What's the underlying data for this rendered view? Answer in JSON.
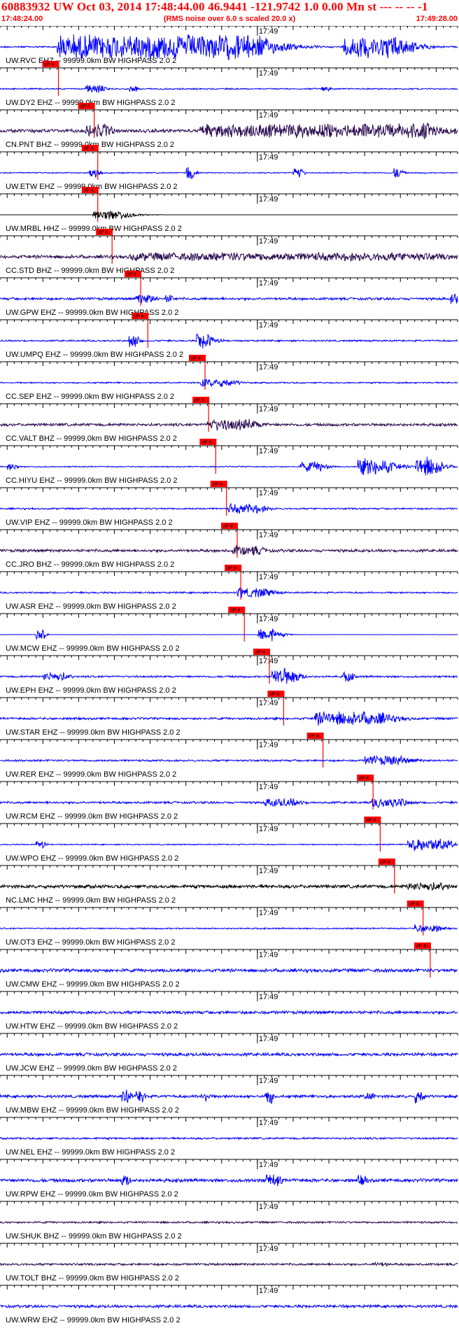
{
  "header": {
    "title": "60883932 UW Oct 03, 2014 17:48:44.00    46.9441 -121.9742  1.0 0.00 Mn st --- -- --   -1",
    "start_time": "17:48:24.00",
    "end_time": "17:49:28.00",
    "rms_note": "(RMS noise over 6.0 s scaled 20.0 x)"
  },
  "colors": {
    "title": "#ff0000",
    "pick_box": "#ff0000",
    "trace_blue": "#0000ff",
    "trace_dark": "#2a0a50",
    "trace_black": "#000000",
    "axis": "#000000"
  },
  "chart_data": {
    "type": "line",
    "title": "60883932 UW Oct 03, 2014 17:48:44.00    46.9441 -121.9742  1.0 0.00 Mn st --- -- --   -1",
    "x_range": [
      "17:48:24.00",
      "17:49:28.00"
    ],
    "minute_tick_label": "17:49",
    "pick_label": "xP 4",
    "tick_interval_s": 1,
    "grid": false,
    "filter_note": "(RMS noise over 6.0 s scaled 20.0 x)",
    "series": [
      {
        "name": "UW.RVC EHZ -- 99999.0km BW  HIGHPASS  2.0  2",
        "color": "#0000ff",
        "pick_s": 7.0,
        "bursts": [
          [
            8,
            36,
            6,
            0.9
          ],
          [
            48,
            56,
            4,
            0.8
          ]
        ],
        "base": 0.06
      },
      {
        "name": "UW.DY2 EHZ -- 99999.0km BW  HIGHPASS  2.0  2",
        "color": "#0000ff",
        "pick_s": 12.0,
        "bursts": [
          [
            12,
            14,
            2,
            0.3
          ],
          [
            18,
            19,
            1,
            0.2
          ],
          [
            45,
            46,
            1,
            0.2
          ]
        ],
        "base": 0.05
      },
      {
        "name": "CN.PNT BHZ -- 99999.0km BW  HIGHPASS  2.0  2",
        "color": "#2a0a50",
        "pick_s": 12.5,
        "bursts": [
          [
            12,
            15,
            2,
            0.5
          ],
          [
            28,
            60,
            8,
            0.5
          ],
          [
            57,
            60,
            3,
            0.6
          ]
        ],
        "base": 0.12
      },
      {
        "name": "UW.ETW EHZ -- 99999.0km BW  HIGHPASS  2.0  2",
        "color": "#0000ff",
        "pick_s": 12.5,
        "bursts": [
          [
            12.5,
            13.5,
            1,
            0.35
          ],
          [
            26,
            27,
            0.8,
            0.5
          ],
          [
            41,
            42,
            0.8,
            0.5
          ],
          [
            55,
            56,
            0.8,
            0.4
          ]
        ],
        "base": 0.04
      },
      {
        "name": "UW.MRBL HHZ -- 99999.0km BW  HIGHPASS  2.0  2",
        "color": "#000000",
        "pick_s": 14.5,
        "bursts": [
          [
            13,
            17,
            3,
            0.35
          ]
        ],
        "base": 0.0
      },
      {
        "name": "CC.STD BHZ -- 99999.0km BW  HIGHPASS  2.0  2",
        "color": "#2a0a50",
        "pick_s": 18.5,
        "bursts": [
          [
            18,
            60,
            10,
            0.3
          ]
        ],
        "base": 0.12
      },
      {
        "name": "UW.GPW EHZ -- 99999.0km BW  HIGHPASS  2.0  2",
        "color": "#0000ff",
        "pick_s": 19.5,
        "bursts": [
          [
            19,
            21,
            2,
            0.35
          ],
          [
            23,
            24,
            1,
            0.3
          ],
          [
            63,
            64,
            0.8,
            0.4
          ]
        ],
        "base": 0.09
      },
      {
        "name": "UW.UMPQ EHZ -- 99999.0km BW  HIGHPASS  2.0  2",
        "color": "#0000ff",
        "pick_s": 27.5,
        "bursts": [
          [
            18,
            19,
            1,
            0.5
          ],
          [
            27.5,
            29,
            2,
            0.6
          ]
        ],
        "base": 0.06
      },
      {
        "name": "CC.SEP EHZ -- 99999.0km BW  HIGHPASS  2.0  2",
        "color": "#0000ff",
        "pick_s": 28.0,
        "bursts": [
          [
            28,
            32,
            3,
            0.3
          ]
        ],
        "base": 0.05
      },
      {
        "name": "CC.VALT BHZ -- 99999.0km BW  HIGHPASS  2.0  2",
        "color": "#2a0a50",
        "pick_s": 29.0,
        "bursts": [
          [
            29,
            35,
            4,
            0.4
          ]
        ],
        "base": 0.1
      },
      {
        "name": "CC.HIYU EHZ -- 99999.0km BW  HIGHPASS  2.0  2",
        "color": "#0000ff",
        "pick_s": 30.5,
        "bursts": [
          [
            1,
            2,
            1,
            0.3
          ],
          [
            42,
            45,
            2,
            0.35
          ],
          [
            50,
            54,
            3,
            0.6
          ],
          [
            58,
            61,
            2,
            0.7
          ]
        ],
        "base": 0.04
      },
      {
        "name": "UW.VIP EHZ -- 99999.0km BW  HIGHPASS  2.0  2",
        "color": "#0000ff",
        "pick_s": 32.0,
        "bursts": [
          [
            32,
            36,
            3,
            0.35
          ]
        ],
        "base": 0.06
      },
      {
        "name": "CC.JRO BHZ -- 99999.0km BW  HIGHPASS  2.0  2",
        "color": "#2a0a50",
        "pick_s": 32.5,
        "bursts": [
          [
            32.5,
            36,
            3,
            0.35
          ]
        ],
        "base": 0.1
      },
      {
        "name": "UW.ASR EHZ -- 99999.0km BW  HIGHPASS  2.0  2",
        "color": "#0000ff",
        "pick_s": 33.0,
        "bursts": [
          [
            33,
            37,
            3,
            0.35
          ]
        ],
        "base": 0.06
      },
      {
        "name": "UW.MCW EHZ -- 99999.0km BW  HIGHPASS  2.0  2",
        "color": "#0000ff",
        "pick_s": 36.5,
        "bursts": [
          [
            5,
            6,
            0.6,
            0.5
          ],
          [
            36,
            38,
            2,
            0.5
          ]
        ],
        "base": 0.01
      },
      {
        "name": "UW.EPH EHZ -- 99999.0km BW  HIGHPASS  2.0  2",
        "color": "#0000ff",
        "pick_s": 38.5,
        "bursts": [
          [
            6,
            9,
            2,
            0.3
          ],
          [
            38,
            41,
            2,
            0.6
          ],
          [
            48,
            49,
            1,
            0.4
          ]
        ],
        "base": 0.07
      },
      {
        "name": "UW.STAR EHZ -- 99999.0km BW  HIGHPASS  2.0  2",
        "color": "#0000ff",
        "pick_s": 44.0,
        "bursts": [
          [
            44,
            53,
            5,
            0.5
          ]
        ],
        "base": 0.08
      },
      {
        "name": "UW.RER EHZ -- 99999.0km BW  HIGHPASS  2.0  2",
        "color": "#0000ff",
        "pick_s": 51.0,
        "bursts": [
          [
            51,
            56,
            4,
            0.35
          ]
        ],
        "base": 0.07
      },
      {
        "name": "UW.RCM EHZ -- 99999.0km BW  HIGHPASS  2.0  2",
        "color": "#0000ff",
        "pick_s": 52.0,
        "bursts": [
          [
            37,
            41,
            3,
            0.3
          ],
          [
            52,
            56,
            3,
            0.35
          ]
        ],
        "base": 0.08
      },
      {
        "name": "UW.WPO EHZ -- 99999.0km BW  HIGHPASS  2.0  2",
        "color": "#0000ff",
        "pick_s": 54.0,
        "bursts": [
          [
            5,
            6,
            0.8,
            0.3
          ],
          [
            57,
            62,
            3,
            0.45
          ]
        ],
        "base": 0.04
      },
      {
        "name": "NC.LMC HHZ -- 99999.0km BW  HIGHPASS  2.0  2",
        "color": "#000000",
        "pick_s": 58.0,
        "bursts": [
          [
            57,
            62,
            3,
            0.3
          ]
        ],
        "base": 0.12
      },
      {
        "name": "UW.OT3 EHZ -- 99999.0km BW  HIGHPASS  2.0  2",
        "color": "#0000ff",
        "pick_s": 59.0,
        "bursts": [
          [
            58,
            61,
            2,
            0.3
          ]
        ],
        "base": 0.05
      },
      {
        "name": "UW.CMW EHZ -- 99999.0km BW  HIGHPASS  2.0  2",
        "color": "#0000ff",
        "pick_s": null,
        "bursts": [],
        "base": 0.12
      },
      {
        "name": "UW.HTW EHZ -- 99999.0km BW  HIGHPASS  2.0  2",
        "color": "#0000ff",
        "pick_s": null,
        "bursts": [],
        "base": 0.11
      },
      {
        "name": "UW.JCW EHZ -- 99999.0km BW  HIGHPASS  2.0  2",
        "color": "#0000ff",
        "pick_s": null,
        "bursts": [],
        "base": 0.11
      },
      {
        "name": "UW.MBW EHZ -- 99999.0km BW  HIGHPASS  2.0  2",
        "color": "#0000ff",
        "pick_s": null,
        "bursts": [
          [
            17,
            18,
            0.8,
            0.5
          ],
          [
            19,
            20,
            0.8,
            0.5
          ],
          [
            28,
            29,
            0.8,
            0.4
          ],
          [
            37,
            38,
            0.8,
            0.5
          ],
          [
            51,
            52,
            0.8,
            0.4
          ],
          [
            58,
            59,
            0.8,
            0.5
          ]
        ],
        "base": 0.1
      },
      {
        "name": "UW.NEL EHZ -- 99999.0km BW  HIGHPASS  2.0  2",
        "color": "#0000ff",
        "pick_s": null,
        "bursts": [],
        "base": 0.07
      },
      {
        "name": "UW.RPW EHZ -- 99999.0km BW  HIGHPASS  2.0  2",
        "color": "#0000ff",
        "pick_s": null,
        "bursts": [
          [
            17,
            18,
            0.8,
            0.4
          ],
          [
            37,
            39,
            1,
            0.45
          ],
          [
            50,
            51,
            0.8,
            0.4
          ]
        ],
        "base": 0.12
      },
      {
        "name": "UW.SHUK BHZ -- 99999.0km BW  HIGHPASS  2.0  2",
        "color": "#2a0a50",
        "pick_s": null,
        "bursts": [],
        "base": 0.07
      },
      {
        "name": "UW.TOLT BHZ -- 99999.0km BW  HIGHPASS  2.0  2",
        "color": "#2a0a50",
        "pick_s": null,
        "bursts": [
          [
            52,
            54,
            2,
            0.15
          ]
        ],
        "base": 0.08
      },
      {
        "name": "UW.WRW EHZ -- 99999.0km BW  HIGHPASS  2.0  2",
        "color": "#0000ff",
        "pick_s": null,
        "bursts": [],
        "base": 0.1
      }
    ]
  }
}
